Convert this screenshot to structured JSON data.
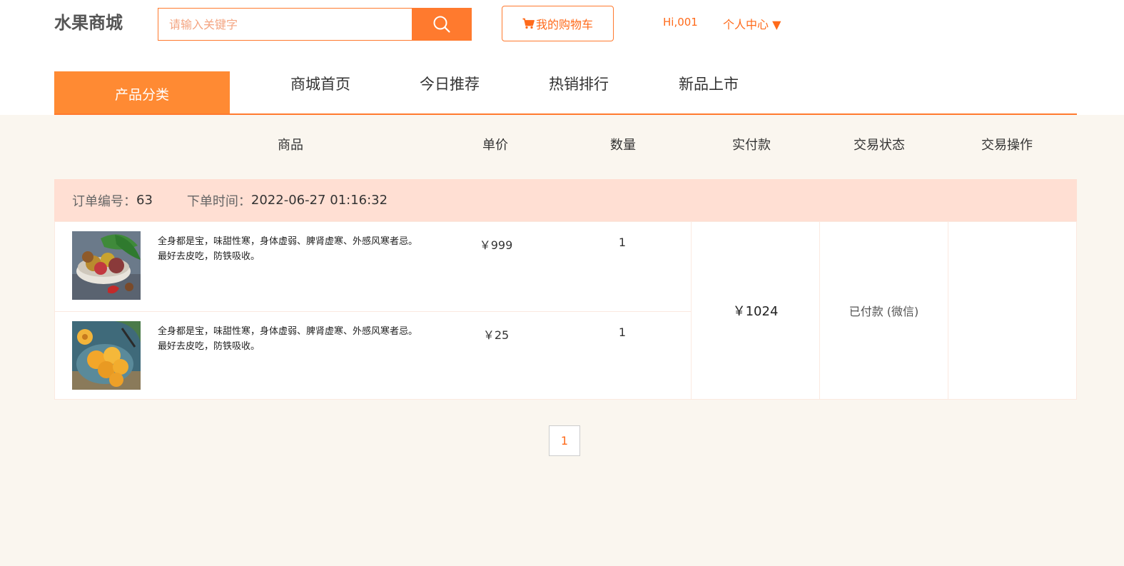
{
  "header": {
    "logo": "水果商城",
    "search_placeholder": "请输入关键字",
    "cart_label": "我的购物车",
    "greeting": "Hi,001",
    "personal_center": "个人中心 ▼"
  },
  "nav": {
    "category_label": "产品分类",
    "items": [
      "商城首页",
      "今日推荐",
      "热销排行",
      "新品上市"
    ]
  },
  "table": {
    "headers": [
      "商品",
      "单价",
      "数量",
      "实付款",
      "交易状态",
      "交易操作"
    ]
  },
  "order": {
    "id_label": "订单编号：",
    "id_value": "63",
    "time_label": "下单时间：",
    "time_value": "2022-06-27 01:16:32",
    "items": [
      {
        "description": "全身都是宝，味甜性寒，身体虚弱、脾肾虚寒、外感风寒者忌。最好去皮吃，防铁吸收。",
        "price": "￥999",
        "quantity": "1",
        "image": "plum-fruit-image"
      },
      {
        "description": "全身都是宝，味甜性寒，身体虚弱、脾肾虚寒、外感风寒者忌。最好去皮吃，防铁吸收。",
        "price": "￥25",
        "quantity": "1",
        "image": "apricot-fruit-image"
      }
    ],
    "total": "￥1024",
    "status": "已付款 (微信)"
  },
  "pagination": {
    "current_page": "1"
  },
  "colors": {
    "accent": "#ff7a2e",
    "nav_category_bg": "#ff8a33",
    "order_header_bg": "#ffdfd3",
    "page_bg": "#faf6ef"
  }
}
